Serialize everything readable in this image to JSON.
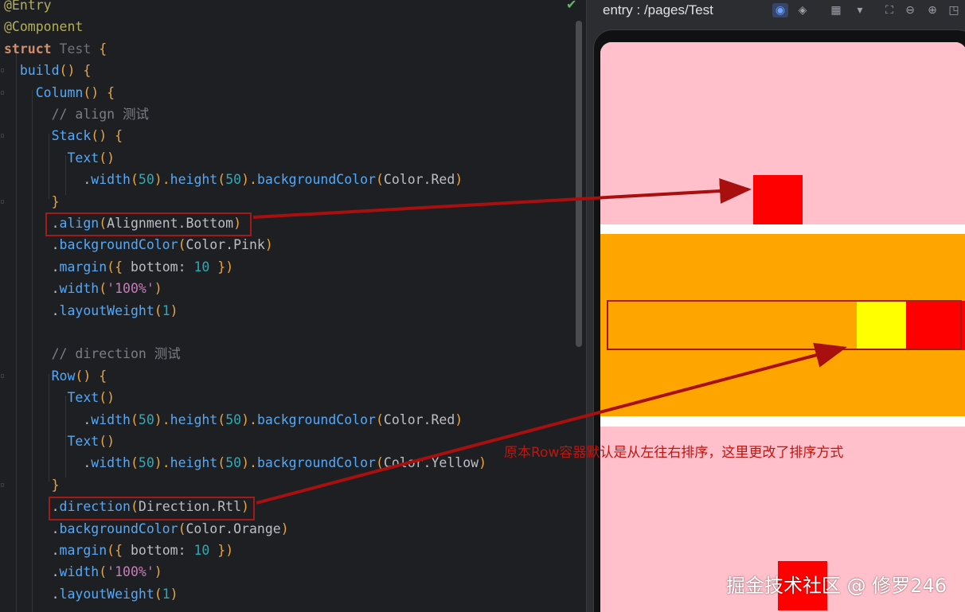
{
  "editor": {
    "lines": [
      [
        [
          "@Entry",
          "deco"
        ]
      ],
      [
        [
          "@Component",
          "deco"
        ]
      ],
      [
        [
          "struct ",
          "kw"
        ],
        [
          "Test ",
          "type"
        ],
        [
          "{",
          "punc"
        ]
      ],
      [
        [
          "  build",
          "fn"
        ],
        [
          "() {",
          "punc"
        ]
      ],
      [
        [
          "    Column",
          "fn"
        ],
        [
          "() {",
          "punc"
        ]
      ],
      [
        [
          "      // align 测试",
          "cmt"
        ]
      ],
      [
        [
          "      Stack",
          "fn"
        ],
        [
          "() {",
          "punc"
        ]
      ],
      [
        [
          "        Text",
          "fn"
        ],
        [
          "()",
          "punc"
        ]
      ],
      [
        [
          "          .",
          "plain"
        ],
        [
          "width",
          "fn"
        ],
        [
          "(",
          "punc"
        ],
        [
          "50",
          "num"
        ],
        [
          ").",
          "punc"
        ],
        [
          "height",
          "fn"
        ],
        [
          "(",
          "punc"
        ],
        [
          "50",
          "num"
        ],
        [
          ").",
          "punc"
        ],
        [
          "backgroundColor",
          "fn"
        ],
        [
          "(",
          "punc"
        ],
        [
          "Color.Red",
          "plain"
        ],
        [
          ")",
          "punc"
        ]
      ],
      [
        [
          "      }",
          "punc"
        ]
      ],
      [
        [
          "      .",
          "plain"
        ],
        [
          "align",
          "fn"
        ],
        [
          "(",
          "punc"
        ],
        [
          "Alignment.Bottom",
          "plain"
        ],
        [
          ")",
          "punc"
        ]
      ],
      [
        [
          "      .",
          "plain"
        ],
        [
          "backgroundColor",
          "fn"
        ],
        [
          "(",
          "punc"
        ],
        [
          "Color.Pink",
          "plain"
        ],
        [
          ")",
          "punc"
        ]
      ],
      [
        [
          "      .",
          "plain"
        ],
        [
          "margin",
          "fn"
        ],
        [
          "({ ",
          "punc"
        ],
        [
          "bottom",
          "plain"
        ],
        [
          ": ",
          "plain"
        ],
        [
          "10",
          "num"
        ],
        [
          " })",
          "punc"
        ]
      ],
      [
        [
          "      .",
          "plain"
        ],
        [
          "width",
          "fn"
        ],
        [
          "(",
          "punc"
        ],
        [
          "'100%'",
          "str"
        ],
        [
          ")",
          "punc"
        ]
      ],
      [
        [
          "      .",
          "plain"
        ],
        [
          "layoutWeight",
          "fn"
        ],
        [
          "(",
          "punc"
        ],
        [
          "1",
          "num"
        ],
        [
          ")",
          "punc"
        ]
      ],
      [
        [
          "",
          "plain"
        ]
      ],
      [
        [
          "      // direction 测试",
          "cmt"
        ]
      ],
      [
        [
          "      Row",
          "fn"
        ],
        [
          "() {",
          "punc"
        ]
      ],
      [
        [
          "        Text",
          "fn"
        ],
        [
          "()",
          "punc"
        ]
      ],
      [
        [
          "          .",
          "plain"
        ],
        [
          "width",
          "fn"
        ],
        [
          "(",
          "punc"
        ],
        [
          "50",
          "num"
        ],
        [
          ").",
          "punc"
        ],
        [
          "height",
          "fn"
        ],
        [
          "(",
          "punc"
        ],
        [
          "50",
          "num"
        ],
        [
          ").",
          "punc"
        ],
        [
          "backgroundColor",
          "fn"
        ],
        [
          "(",
          "punc"
        ],
        [
          "Color.Red",
          "plain"
        ],
        [
          ")",
          "punc"
        ]
      ],
      [
        [
          "        Text",
          "fn"
        ],
        [
          "()",
          "punc"
        ]
      ],
      [
        [
          "          .",
          "plain"
        ],
        [
          "width",
          "fn"
        ],
        [
          "(",
          "punc"
        ],
        [
          "50",
          "num"
        ],
        [
          ").",
          "punc"
        ],
        [
          "height",
          "fn"
        ],
        [
          "(",
          "punc"
        ],
        [
          "50",
          "num"
        ],
        [
          ").",
          "punc"
        ],
        [
          "backgroundColor",
          "fn"
        ],
        [
          "(",
          "punc"
        ],
        [
          "Color.Yellow",
          "plain"
        ],
        [
          ")",
          "punc"
        ]
      ],
      [
        [
          "      }",
          "punc"
        ]
      ],
      [
        [
          "      .",
          "plain"
        ],
        [
          "direction",
          "fn"
        ],
        [
          "(",
          "punc"
        ],
        [
          "Direction.Rtl",
          "plain"
        ],
        [
          ")",
          "punc"
        ]
      ],
      [
        [
          "      .",
          "plain"
        ],
        [
          "backgroundColor",
          "fn"
        ],
        [
          "(",
          "punc"
        ],
        [
          "Color.Orange",
          "plain"
        ],
        [
          ")",
          "punc"
        ]
      ],
      [
        [
          "      .",
          "plain"
        ],
        [
          "margin",
          "fn"
        ],
        [
          "({ ",
          "punc"
        ],
        [
          "bottom",
          "plain"
        ],
        [
          ": ",
          "plain"
        ],
        [
          "10",
          "num"
        ],
        [
          " })",
          "punc"
        ]
      ],
      [
        [
          "      .",
          "plain"
        ],
        [
          "width",
          "fn"
        ],
        [
          "(",
          "punc"
        ],
        [
          "'100%'",
          "str"
        ],
        [
          ")",
          "punc"
        ]
      ],
      [
        [
          "      .",
          "plain"
        ],
        [
          "layoutWeight",
          "fn"
        ],
        [
          "(",
          "punc"
        ],
        [
          "1",
          "num"
        ],
        [
          ")",
          "punc"
        ]
      ]
    ],
    "colors": {
      "deco": "#b3ae60",
      "kw": "#cf8e6d",
      "type": "#6f737a",
      "fn": "#56a8f5",
      "punc": "#e7a548",
      "num": "#2aacb8",
      "str": "#c77dbb",
      "cmt": "#7a7e85",
      "plain": "#bcbec4"
    },
    "status_icon": "check-icon"
  },
  "preview": {
    "title": "entry : /pages/Test",
    "toolbar_icons": [
      "inspect-icon",
      "layers-icon",
      "grid-icon",
      "dropdown-icon",
      "crop-icon",
      "zoom-out-icon",
      "zoom-in-icon",
      "fit-icon"
    ]
  },
  "annotation": {
    "note": "原本Row容器默认是从左往右排序，这里更改了排序方式",
    "arrow_color": "#a80f0f"
  },
  "colors": {
    "pink": "#ffc0cb",
    "orange": "#ffa500",
    "red": "#ff0000",
    "yellow": "#ffff00"
  },
  "watermark": "掘金技术社区 @ 修罗246"
}
